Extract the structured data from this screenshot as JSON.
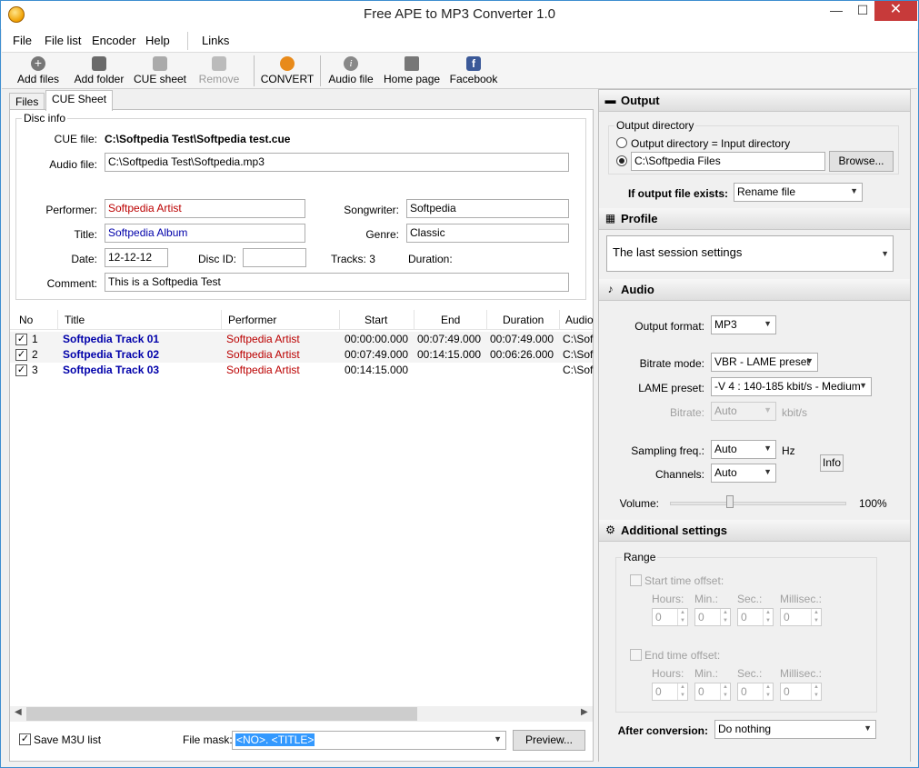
{
  "window": {
    "title": "Free APE to MP3 Converter 1.0",
    "minimize": "—",
    "maximize": "☐",
    "close": "✕"
  },
  "menu": [
    "File",
    "File list",
    "Encoder",
    "Help",
    "Links"
  ],
  "toolbar": {
    "add_files": "Add files",
    "add_folder": "Add folder",
    "cue_sheet": "CUE sheet",
    "remove": "Remove",
    "convert": "CONVERT",
    "audio_file": "Audio file",
    "home_page": "Home page",
    "facebook": "Facebook"
  },
  "tabs": {
    "files": "Files",
    "cue": "CUE Sheet"
  },
  "disc": {
    "group": "Disc info",
    "cue_label": "CUE file:",
    "cue_value": "C:\\Softpedia Test\\Softpedia test.cue",
    "audio_label": "Audio file:",
    "audio_value": "C:\\Softpedia Test\\Softpedia.mp3",
    "performer_label": "Performer:",
    "performer_value": "Softpedia Artist",
    "songwriter_label": "Songwriter:",
    "songwriter_value": "Softpedia",
    "title_label": "Title:",
    "title_value": "Softpedia Album",
    "genre_label": "Genre:",
    "genre_value": "Classic",
    "date_label": "Date:",
    "date_value": "12-12-12",
    "discid_label": "Disc ID:",
    "discid_value": "",
    "tracks_label": "Tracks: 3",
    "duration_label": "Duration:",
    "comment_label": "Comment:",
    "comment_value": "This is a Softpedia Test"
  },
  "list": {
    "headers": [
      "No",
      "Title",
      "Performer",
      "Start",
      "End",
      "Duration",
      "Audio"
    ],
    "rows": [
      {
        "no": "1",
        "title": "Softpedia Track 01",
        "performer": "Softpedia Artist",
        "start": "00:00:00.000",
        "end": "00:07:49.000",
        "duration": "00:07:49.000",
        "audio": "C:\\Sof"
      },
      {
        "no": "2",
        "title": "Softpedia Track 02",
        "performer": "Softpedia Artist",
        "start": "00:07:49.000",
        "end": "00:14:15.000",
        "duration": "00:06:26.000",
        "audio": "C:\\Sof"
      },
      {
        "no": "3",
        "title": "Softpedia Track 03",
        "performer": "Softpedia Artist",
        "start": "00:14:15.000",
        "end": "",
        "duration": "",
        "audio": "C:\\Sof"
      }
    ]
  },
  "bottom": {
    "save_m3u": "Save M3U list",
    "mask_label": "File mask:",
    "mask_value": "<NO>. <TITLE>",
    "preview": "Preview..."
  },
  "output": {
    "header": "Output",
    "dir_group": "Output directory",
    "opt_input": "Output directory = Input directory",
    "dir_value": "C:\\Softpedia Files",
    "browse": "Browse...",
    "exists_label": "If output file exists:",
    "exists_value": "Rename file"
  },
  "profile": {
    "header": "Profile",
    "value": "The last session settings"
  },
  "audio": {
    "header": "Audio",
    "format_label": "Output format:",
    "format_value": "MP3",
    "bitrate_mode_label": "Bitrate mode:",
    "bitrate_mode_value": "VBR - LAME preset",
    "lame_label": "LAME preset:",
    "lame_value": "-V 4 : 140-185 kbit/s - Medium",
    "bitrate_label": "Bitrate:",
    "bitrate_value": "Auto",
    "bitrate_unit": "kbit/s",
    "sampling_label": "Sampling freq.:",
    "sampling_value": "Auto",
    "sampling_unit": "Hz",
    "info": "Info",
    "channels_label": "Channels:",
    "channels_value": "Auto",
    "volume_label": "Volume:",
    "volume_value": "100%"
  },
  "additional": {
    "header": "Additional settings",
    "range": "Range",
    "start_offset": "Start time offset:",
    "end_offset": "End time offset:",
    "hours": "Hours:",
    "min": "Min.:",
    "sec": "Sec.:",
    "milli": "Millisec.:",
    "zero": "0",
    "after_label": "After conversion:",
    "after_value": "Do nothing"
  }
}
